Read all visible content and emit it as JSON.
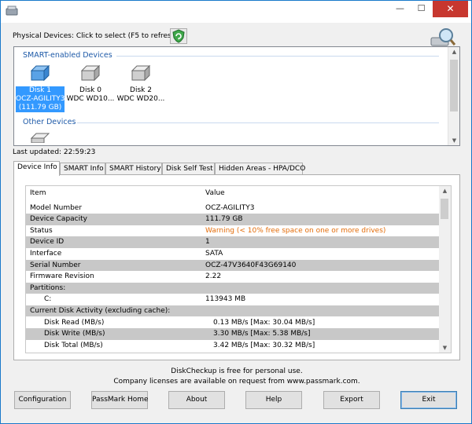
{
  "physical_devices_label": "Physical Devices: Click to select (F5 to refresh)",
  "groups": {
    "smart": "SMART-enabled Devices",
    "other": "Other Devices"
  },
  "disks": [
    {
      "lines": [
        "Disk 1",
        "OCZ-AGILITY3",
        "(111.79 GB)"
      ],
      "selected": true
    },
    {
      "lines": [
        "Disk 0",
        "WDC WD10...",
        ""
      ],
      "selected": false
    },
    {
      "lines": [
        "Disk 2",
        "WDC WD20...",
        ""
      ],
      "selected": false
    }
  ],
  "last_updated": "Last updated: 22:59:23",
  "tabs": [
    "Device Info",
    "SMART Info",
    "SMART History",
    "Disk Self Test",
    "Hidden Areas - HPA/DCO"
  ],
  "table": {
    "headers": [
      "Item",
      "Value"
    ],
    "rows": [
      {
        "item": "Model Number",
        "value": "OCZ-AGILITY3"
      },
      {
        "item": "Device Capacity",
        "value": "111.79 GB"
      },
      {
        "item": "Status",
        "value": "Warning (< 10% free space on one or more drives)",
        "warn": true
      },
      {
        "item": "Device ID",
        "value": "1"
      },
      {
        "item": "Interface",
        "value": "SATA"
      },
      {
        "item": "Serial Number",
        "value": "OCZ-47V3640F43G69140"
      },
      {
        "item": "Firmware Revision",
        "value": "2.22"
      },
      {
        "item": "Partitions:",
        "value": ""
      },
      {
        "item": "C:",
        "value": "113943 MB",
        "indent": true
      },
      {
        "item": "Current Disk Activity (excluding cache):",
        "value": ""
      },
      {
        "item": "Disk Read (MB/s)",
        "value": "0.13 MB/s [Max: 30.04 MB/s]",
        "indent": true
      },
      {
        "item": "Disk Write (MB/s)",
        "value": "3.30 MB/s [Max: 5.38 MB/s]",
        "indent": true
      },
      {
        "item": "Disk Total (MB/s)",
        "value": "3.42 MB/s [Max: 30.32 MB/s]",
        "indent": true
      }
    ]
  },
  "footer": {
    "line1": "DiskCheckup is free for personal use.",
    "line2": "Company licenses are available on request from www.passmark.com."
  },
  "buttons": [
    "Configuration",
    "PassMark Home",
    "About",
    "Help",
    "Export",
    "Exit"
  ],
  "window_controls": {
    "minimize": "—",
    "maximize": "☐",
    "close": "✕"
  },
  "icons": {
    "title": "disk-app-icon",
    "refresh": "shield-refresh-icon",
    "search": "magnifier-disk-icon"
  },
  "colors": {
    "accent": "#3399ff",
    "warning": "#e36c09",
    "group_title": "#1e5aa8",
    "window_border": "#1979ca"
  }
}
